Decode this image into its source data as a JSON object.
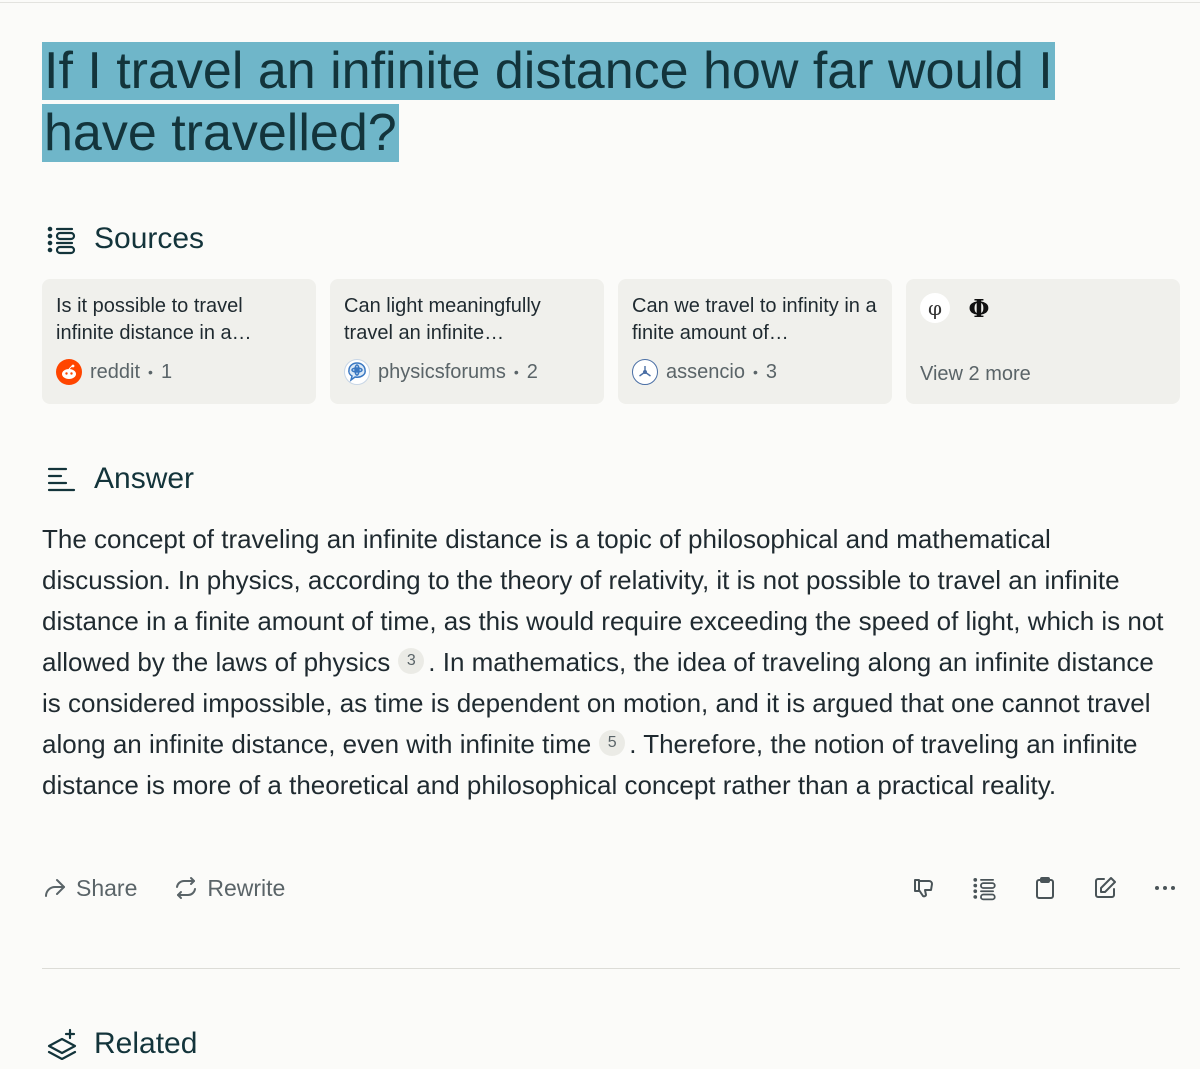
{
  "query": "If I travel an infinite distance how far would I have travelled?",
  "sources": {
    "heading": "Sources",
    "items": [
      {
        "title": "Is it possible to travel infinite distance in a…",
        "site": "reddit",
        "index": "1"
      },
      {
        "title": "Can light meaningfully travel an infinite…",
        "site": "physicsforums",
        "index": "2"
      },
      {
        "title": "Can we travel to infinity in a finite amount of…",
        "site": "assencio",
        "index": "3"
      }
    ],
    "more": {
      "icon_1": "φ",
      "icon_2": "Φ",
      "label": "View 2 more"
    }
  },
  "answer": {
    "heading": "Answer",
    "part1": "The concept of traveling an infinite distance is a topic of philosophical and mathematical discussion. In physics, according to the theory of relativity, it is not possible to travel an infinite distance in a finite amount of time, as this would require exceeding the speed of light, which is not allowed by the laws of physics",
    "cite1": "3",
    "part2": ". In mathematics, the idea of traveling along an infinite distance is considered impossible, as time is dependent on motion, and it is argued that one cannot travel along an infinite distance, even with infinite time",
    "cite2": "5",
    "part3": ". Therefore, the notion of traveling an infinite distance is more of a theoretical and philosophical concept rather than a practical reality."
  },
  "actions": {
    "share_label": "Share",
    "rewrite_label": "Rewrite",
    "right_icons": [
      "thumbs-down-icon",
      "sources-list-icon",
      "clipboard-icon",
      "edit-icon",
      "more-icon"
    ]
  },
  "related": {
    "heading": "Related"
  },
  "colors": {
    "highlight": "#6fb6c9",
    "text": "#13343b",
    "muted": "#5a6468",
    "card_bg": "#f0f0ec",
    "page_bg": "#fbfbf9"
  }
}
